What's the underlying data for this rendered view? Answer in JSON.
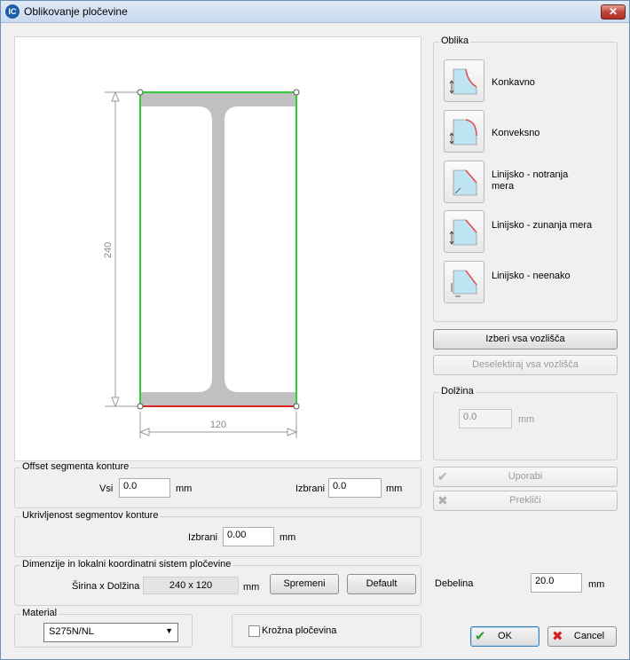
{
  "window": {
    "title": "Oblikovanje pločevine",
    "close_glyph": "✕"
  },
  "drawing": {
    "dim_vertical": "240",
    "dim_horizontal": "120"
  },
  "shape_group": {
    "label": "Oblika",
    "items": [
      {
        "label": "Konkavno",
        "icon": "concave-icon"
      },
      {
        "label": "Konveksno",
        "icon": "convex-icon"
      },
      {
        "label": "Linijsko - notranja mera",
        "icon": "linear-inner-icon"
      },
      {
        "label": "Linijsko - zunanja mera",
        "icon": "linear-outer-icon"
      },
      {
        "label": "Linijsko - neenako",
        "icon": "linear-unequal-icon"
      }
    ]
  },
  "select_all_label": "Izberi vsa vozlišča",
  "deselect_all_label": "Deselektiraj vsa vozlišča",
  "length_group": {
    "label": "Dolžina",
    "value": "0.0",
    "unit": "mm"
  },
  "apply_label": "Uporabi",
  "cancel_edit_label": "Prekliči",
  "offset_group": {
    "label": "Offset segmenta konture",
    "all_label": "Vsi",
    "all_value": "0.0",
    "selected_label": "Izbrani",
    "selected_value": "0.0",
    "unit": "mm"
  },
  "curvature_group": {
    "label": "Ukrivljenost segmentov konture",
    "selected_label": "Izbrani",
    "selected_value": "0.00",
    "unit": "mm"
  },
  "dims_group": {
    "label": "Dimenzije in lokalni koordinatni sistem pločevine",
    "wl_label": "Širina x Dolžina",
    "wl_value": "240 x 120",
    "unit": "mm",
    "change_label": "Spremeni",
    "default_label": "Default"
  },
  "material_group": {
    "label": "Material",
    "value": "S275N/NL"
  },
  "circular_label": "Krožna pločevina",
  "thickness": {
    "label": "Debelina",
    "value": "20.0",
    "unit": "mm"
  },
  "ok_label": "OK",
  "cancel_label": "Cancel",
  "colors": {
    "selected_edge": "#33cc33",
    "edge_red": "#dd2222",
    "profile_gray": "#c0c0c0"
  }
}
